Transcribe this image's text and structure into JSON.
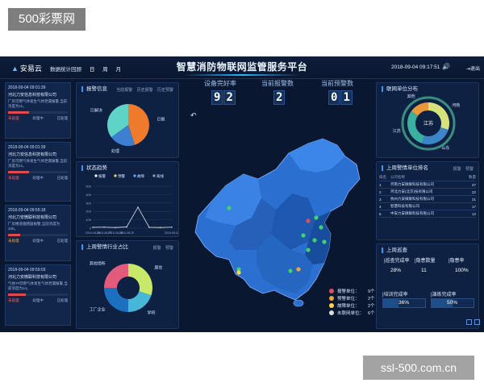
{
  "watermarks": {
    "top": "500彩票网",
    "bottom": "ssl-500.com.cn"
  },
  "header": {
    "logo": "安易云",
    "nav": [
      "数据统计回顾",
      "日",
      "周",
      "月"
    ],
    "title": "智慧消防物联网监管服务平台",
    "datetime": "2018-09-04 09:17:51",
    "exit": "退出"
  },
  "stats": [
    {
      "label": "设备完好率",
      "value": "92"
    },
    {
      "label": "当前报警数",
      "value": "2"
    },
    {
      "label": "当前预警数",
      "value": "01"
    }
  ],
  "alarm_cards": [
    {
      "time": "2018-09-04 09:01:39",
      "company": "河北力安信息科技有限公司",
      "desc": "厂房可燃气体发生气体泄漏报警,当前浓度为11。",
      "progress": 0.35,
      "actions": [
        "未处理",
        "处理中",
        "已处理"
      ]
    },
    {
      "time": "2018-09-04 09:01:39",
      "company": "河北力安信息科技有限公司",
      "desc": "厂房可燃气体发生气体泄漏报警,当前浓度为11。",
      "progress": 0.35,
      "actions": [
        "未处理",
        "处理中",
        "已处理"
      ]
    },
    {
      "time": "2018-09-04 09:55:18",
      "company": "河北力安微联科技有限公司",
      "desc": "厂房楼道烟感器报警,当前浓度为100。",
      "progress": 0.2,
      "actions": [
        "未处理",
        "处理中",
        "已处理"
      ]
    },
    {
      "time": "2018-09-04 09:59:03",
      "company": "河北力安微联科技有限公司",
      "desc": "气体7#可燃气体发生气体泄漏报警,当前浓度为14。",
      "progress": 0.3,
      "actions": [
        "未处理",
        "处理中",
        "已处理"
      ]
    }
  ],
  "warning_panel": {
    "title": "报警信息",
    "tabs": [
      "当前报警",
      "历史报警",
      "历史预警"
    ],
    "slices": [
      {
        "label": "已报",
        "value": 45,
        "color": "#ee7a2b"
      },
      {
        "label": "处理",
        "value": 20,
        "color": "#3d7fd0"
      },
      {
        "label": "已解决",
        "value": 35,
        "color": "#5fd3c6"
      }
    ]
  },
  "trend_panel": {
    "title": "状态趋势",
    "legend": [
      "报警",
      "预警",
      "故障",
      "离线"
    ],
    "legend_colors": [
      "#ffffff",
      "#f5d26b",
      "#5fa8ff",
      "#9c9c9c"
    ],
    "chart_data": {
      "type": "line",
      "x": [
        "2018-08-26",
        "2018-08-27",
        "2018-08-28",
        "2018-08-29",
        "2018-08-30",
        "2018-08-31",
        "2018-09-01",
        "2018-09-02"
      ],
      "x_tick_labels": [
        "2018-08-26",
        "2018-08-27",
        "2018-08-28",
        "2018-08-29",
        "2018-09-02"
      ],
      "y_ticks": [
        0,
        100,
        200,
        300,
        400,
        500
      ],
      "ylim": [
        0,
        500
      ],
      "series": [
        {
          "name": "预警",
          "values": [
            10,
            12,
            8,
            15,
            250,
            10,
            8,
            12
          ],
          "color": "#e0e0e0"
        }
      ]
    }
  },
  "industry_panel": {
    "title": "上周警情行业占比",
    "tabs": [
      "报警",
      "预警"
    ],
    "slices": [
      {
        "label": "居住",
        "value": 30,
        "color": "#c8e86a"
      },
      {
        "label": "学校",
        "value": 20,
        "color": "#46b7d6"
      },
      {
        "label": "工厂企业",
        "value": 25,
        "color": "#1d6fc0"
      },
      {
        "label": "其他场所",
        "value": 25,
        "color": "#e25b7d"
      }
    ]
  },
  "map_legend": [
    {
      "label": "报警单位：",
      "count": "9个",
      "color": "#e0505a"
    },
    {
      "label": "预警单位：",
      "count": "2个",
      "color": "#f0a43a"
    },
    {
      "label": "故障单位：",
      "count": "2个",
      "color": "#ffd54a"
    },
    {
      "label": "未联网单位：",
      "count": "6个",
      "color": "#dcdcdc"
    }
  ],
  "distribution_panel": {
    "title": "联网单位分布",
    "center_label": "江苏",
    "labels": [
      "河南",
      "山东",
      "江苏",
      "其他"
    ],
    "values": [
      30,
      25,
      30,
      15
    ],
    "colors": [
      "#d6e37a",
      "#3b86c9",
      "#39b0a0",
      "#e8983a"
    ]
  },
  "ranking_panel": {
    "title": "上周警情单位排名",
    "tabs": [
      "报警",
      "预警"
    ],
    "headers": [
      "排名",
      "公司名称",
      "数量"
    ],
    "rows": [
      {
        "rank": "1",
        "name": "河南力安微联科技有限公司",
        "count": "27"
      },
      {
        "rank": "2",
        "name": "河北力安(北京)技有限公司",
        "count": "22"
      },
      {
        "rank": "3",
        "name": "杭州力安微联科技有限公司",
        "count": "21"
      },
      {
        "rank": "4",
        "name": "智慧科技有限公司",
        "count": "17"
      },
      {
        "rank": "5",
        "name": "中安力安微联科技有限公司",
        "count": "12"
      }
    ]
  },
  "inspection_panel": {
    "title": "上周巡查",
    "metrics": [
      {
        "label": "巡查完成率",
        "value": "28%"
      },
      {
        "label": "隐患数量",
        "value": "11"
      },
      {
        "label": "隐患率",
        "value": "100%"
      }
    ],
    "rates": [
      {
        "label": "培训完成率",
        "value": "36%",
        "fraction": 0.36
      },
      {
        "label": "演练完成率",
        "value": "50%",
        "fraction": 0.5
      }
    ]
  }
}
